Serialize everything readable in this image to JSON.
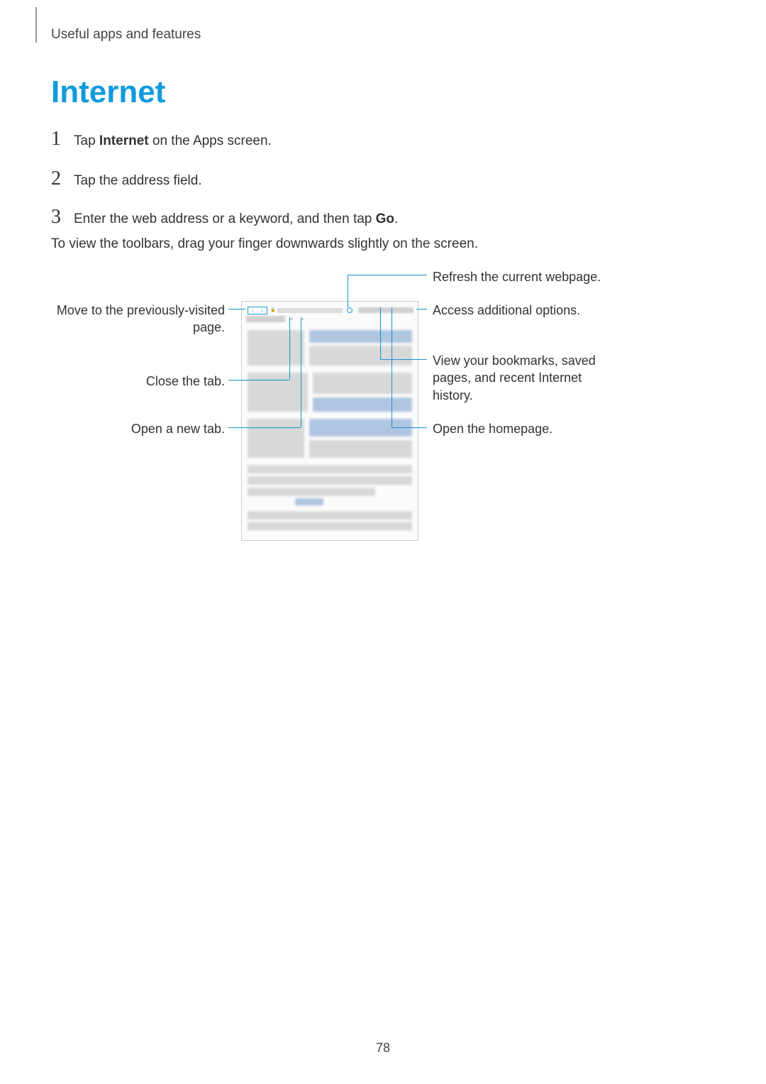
{
  "header": "Useful apps and features",
  "title": "Internet",
  "steps": {
    "s1": {
      "num": "1",
      "pre": "Tap ",
      "bold": "Internet",
      "post": " on the Apps screen."
    },
    "s2": {
      "num": "2",
      "pre": "Tap the address field.",
      "bold": "",
      "post": ""
    },
    "s3": {
      "num": "3",
      "pre": "Enter the web address or a keyword, and then tap ",
      "bold": "Go",
      "post": "."
    }
  },
  "caption": "To view the toolbars, drag your finger downwards slightly on the screen.",
  "callouts": {
    "refresh": "Refresh the current webpage.",
    "options": "Access additional options.",
    "bookmarks": "View your bookmarks, saved pages, and recent Internet history.",
    "homepage": "Open the homepage.",
    "back": "Move to the previously-visited page.",
    "close": "Close the tab.",
    "newtab": "Open a new tab."
  },
  "page_number": "78"
}
